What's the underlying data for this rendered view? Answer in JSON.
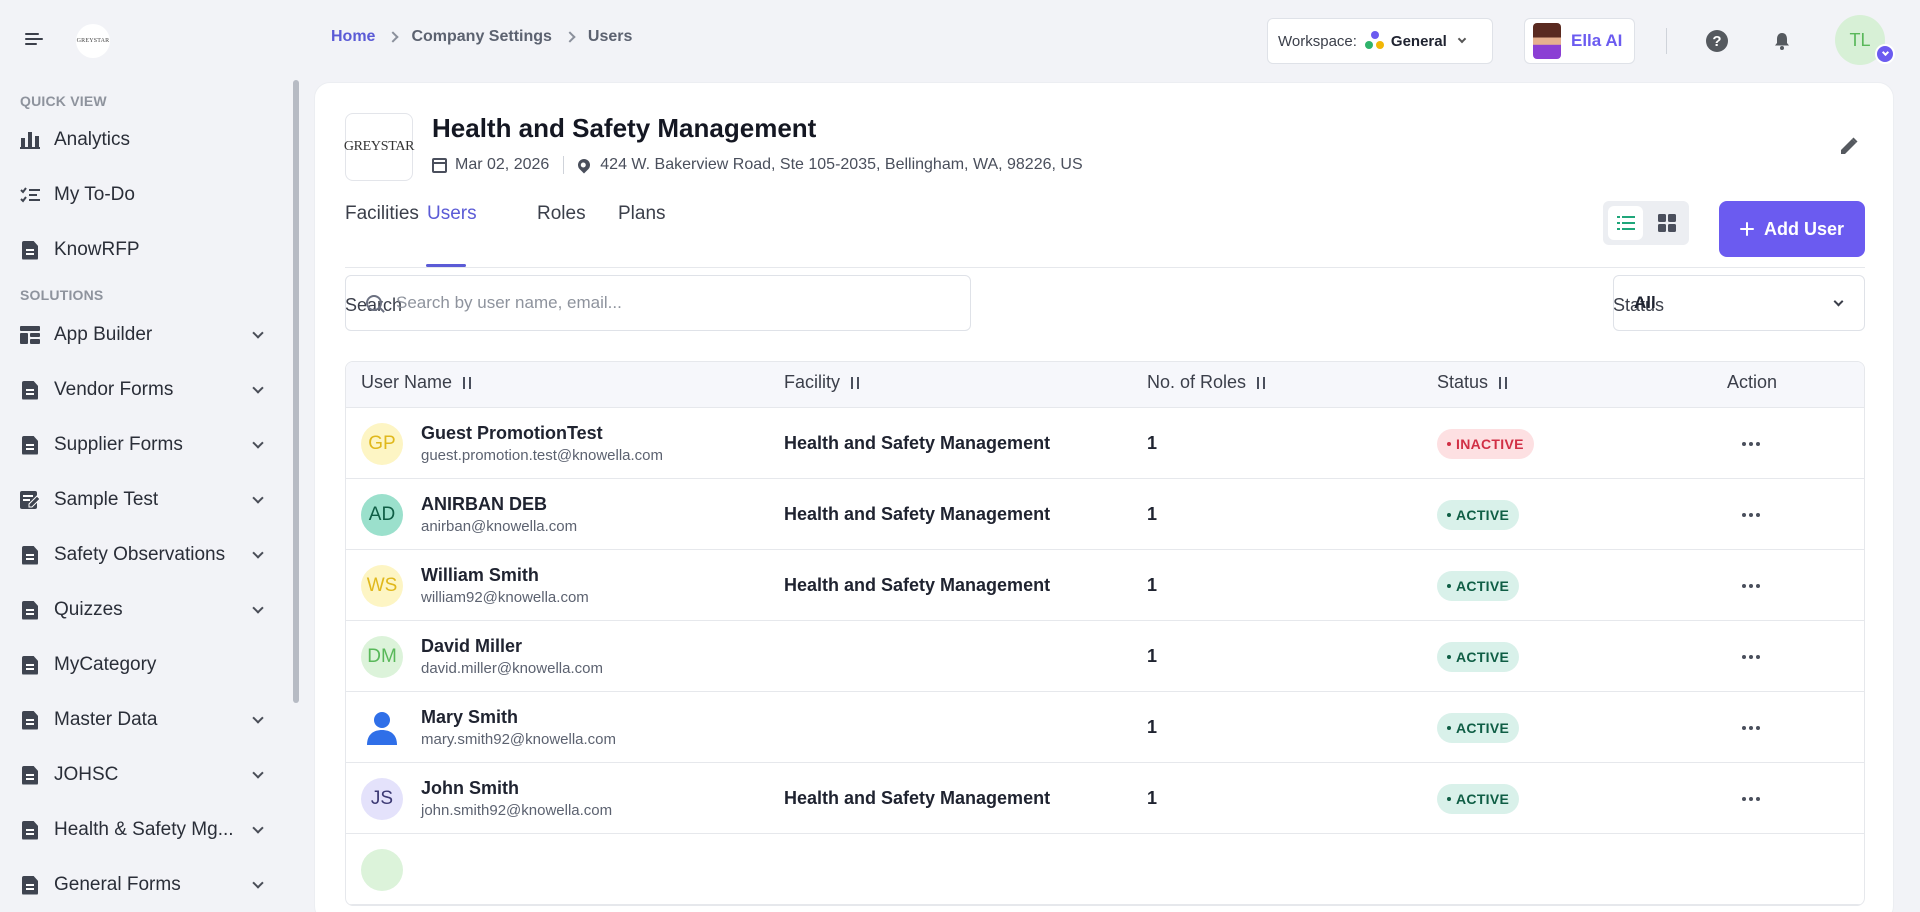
{
  "topbar": {
    "brand_logo_text": "GREYSTAR",
    "breadcrumb": [
      "Home",
      "Company Settings",
      "Users"
    ],
    "workspace_label": "Workspace:",
    "workspace_value": "General",
    "assistant_label": "Ella AI",
    "help_glyph": "?",
    "user_initials": "TL"
  },
  "sidebar": {
    "quick_view_title": "QUICK VIEW",
    "solutions_title": "SOLUTIONS",
    "quick_view": [
      {
        "label": "Analytics",
        "icon": "bar-chart-icon"
      },
      {
        "label": "My To-Do",
        "icon": "checklist-icon"
      },
      {
        "label": "KnowRFP",
        "icon": "document-icon"
      }
    ],
    "solutions": [
      {
        "label": "App Builder",
        "icon": "dashboard-icon",
        "expandable": true
      },
      {
        "label": "Vendor Forms",
        "icon": "document-icon",
        "expandable": true
      },
      {
        "label": "Supplier Forms",
        "icon": "document-icon",
        "expandable": true
      },
      {
        "label": "Sample Test",
        "icon": "edit-note-icon",
        "expandable": true
      },
      {
        "label": "Safety Observations",
        "icon": "document-icon",
        "expandable": true
      },
      {
        "label": "Quizzes",
        "icon": "document-icon",
        "expandable": true
      },
      {
        "label": "MyCategory",
        "icon": "document-icon",
        "expandable": false
      },
      {
        "label": "Master Data",
        "icon": "document-icon",
        "expandable": true
      },
      {
        "label": "JOHSC",
        "icon": "document-icon",
        "expandable": true
      },
      {
        "label": "Health & Safety Mg...",
        "icon": "document-icon",
        "expandable": true
      },
      {
        "label": "General Forms",
        "icon": "document-icon",
        "expandable": true
      }
    ]
  },
  "company": {
    "logo_text": "GREYSTAR",
    "title": "Health and Safety Management",
    "date": "Mar 02, 2026",
    "address": "424 W. Bakerview Road, Ste 105-2035, Bellingham, WA, 98226, US"
  },
  "tabs": [
    "Facilities",
    "Users",
    "Roles",
    "Plans"
  ],
  "active_tab": "Users",
  "add_user_label": "Add User",
  "filters": {
    "search_label": "Search",
    "search_placeholder": "Search by user name, email...",
    "status_label": "Status",
    "status_value": "All"
  },
  "table": {
    "columns": [
      "User Name",
      "Facility",
      "No. of Roles",
      "Status",
      "Action"
    ],
    "rows": [
      {
        "initials": "GP",
        "name": "Guest PromotionTest",
        "email": "guest.promotion.test@knowella.com",
        "facility": "Health and Safety Management",
        "roles": "1",
        "status": "INACTIVE",
        "avatar_bg": "#fdf5c4",
        "avatar_fg": "#e0b81c"
      },
      {
        "initials": "AD",
        "name": "ANIRBAN DEB",
        "email": "anirban@knowella.com",
        "facility": "Health and Safety Management",
        "roles": "1",
        "status": "ACTIVE",
        "avatar_bg": "#9be0cc",
        "avatar_fg": "#0f5e45"
      },
      {
        "initials": "WS",
        "name": "William Smith",
        "email": "william92@knowella.com",
        "facility": "Health and Safety Management",
        "roles": "1",
        "status": "ACTIVE",
        "avatar_bg": "#fdf5c4",
        "avatar_fg": "#e0b81c"
      },
      {
        "initials": "DM",
        "name": "David Miller",
        "email": "david.miller@knowella.com",
        "facility": "",
        "roles": "1",
        "status": "ACTIVE",
        "avatar_bg": "#dcf3da",
        "avatar_fg": "#59b85a"
      },
      {
        "initials": "",
        "name": "Mary Smith",
        "email": "mary.smith92@knowella.com",
        "facility": "",
        "roles": "1",
        "status": "ACTIVE",
        "avatar_bg": "",
        "avatar_fg": "#2f6fe8"
      },
      {
        "initials": "JS",
        "name": "John Smith",
        "email": "john.smith92@knowella.com",
        "facility": "Health and Safety Management",
        "roles": "1",
        "status": "ACTIVE",
        "avatar_bg": "#e4e2fb",
        "avatar_fg": "#3d3a74"
      }
    ]
  },
  "colors": {
    "accent": "#6b5bf0",
    "link": "#5b5bd6",
    "active_badge_bg": "#d9f1ea",
    "inactive_badge_bg": "#fde0e2"
  }
}
